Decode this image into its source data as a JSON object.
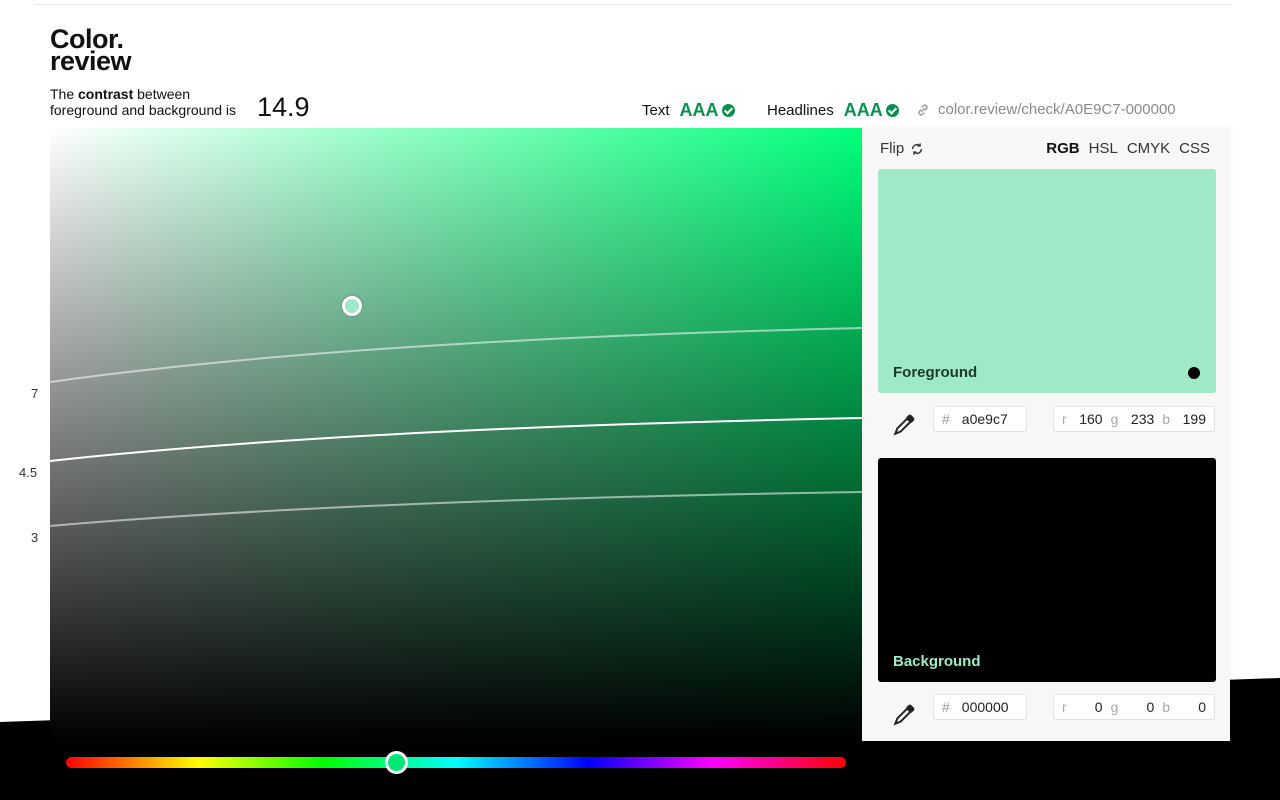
{
  "app": {
    "logo_line1": "Color.",
    "logo_line2": "review"
  },
  "contrast": {
    "prefix": "The",
    "bold": "contrast",
    "suffix": "between",
    "line2": "foreground and background is",
    "value": "14.9"
  },
  "scores": {
    "text_label": "Text",
    "text_grade": "AAA",
    "headlines_label": "Headlines",
    "headlines_grade": "AAA"
  },
  "share": {
    "url": "color.review/check/A0E9C7-000000"
  },
  "picker": {
    "hue_color": "#00ff7a",
    "handle_color": "#a0e9c7",
    "axis_labels": [
      "7",
      "4.5",
      "3"
    ]
  },
  "panel": {
    "flip_label": "Flip",
    "modes": [
      "RGB",
      "HSL",
      "CMYK",
      "CSS"
    ],
    "active_mode": "RGB",
    "foreground": {
      "label": "Foreground",
      "color": "#a0e9c7",
      "hex": "a0e9c7",
      "r_label": "r",
      "r": "160",
      "g_label": "g",
      "g": "233",
      "b_label": "b",
      "b": "199"
    },
    "background": {
      "label": "Background",
      "color": "#000000",
      "hex": "000000",
      "r_label": "r",
      "r": "0",
      "g_label": "g",
      "g": "0",
      "b_label": "b",
      "b": "0"
    }
  },
  "hue_slider": {
    "handle_color": "#00e776"
  },
  "icons": {
    "check": "check-circle-icon",
    "link": "link-icon",
    "flip": "refresh-icon",
    "eyedropper": "eyedropper-icon"
  }
}
